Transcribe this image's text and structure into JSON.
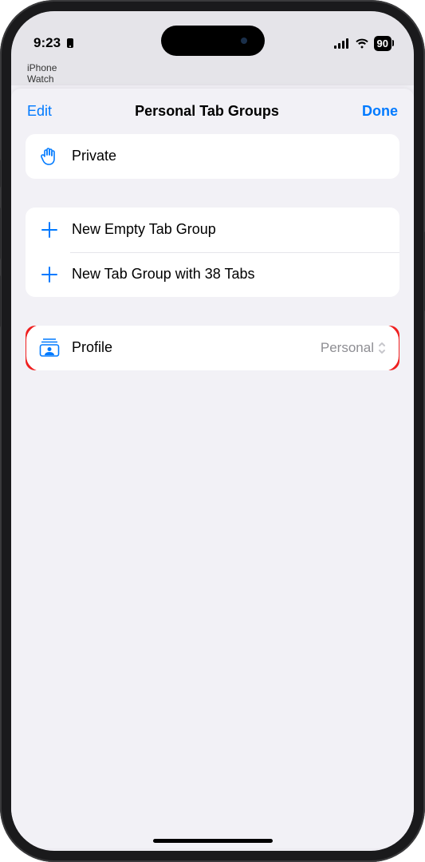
{
  "status": {
    "time": "9:23",
    "battery": "90"
  },
  "background": {
    "line1": "iPhone",
    "line2": "Watch"
  },
  "header": {
    "edit": "Edit",
    "title": "Personal Tab Groups",
    "done": "Done"
  },
  "groups": {
    "private": {
      "label": "Private"
    },
    "actions": {
      "empty": "New Empty Tab Group",
      "with_tabs": "New Tab Group with 38 Tabs"
    },
    "profile": {
      "label": "Profile",
      "value": "Personal"
    }
  }
}
